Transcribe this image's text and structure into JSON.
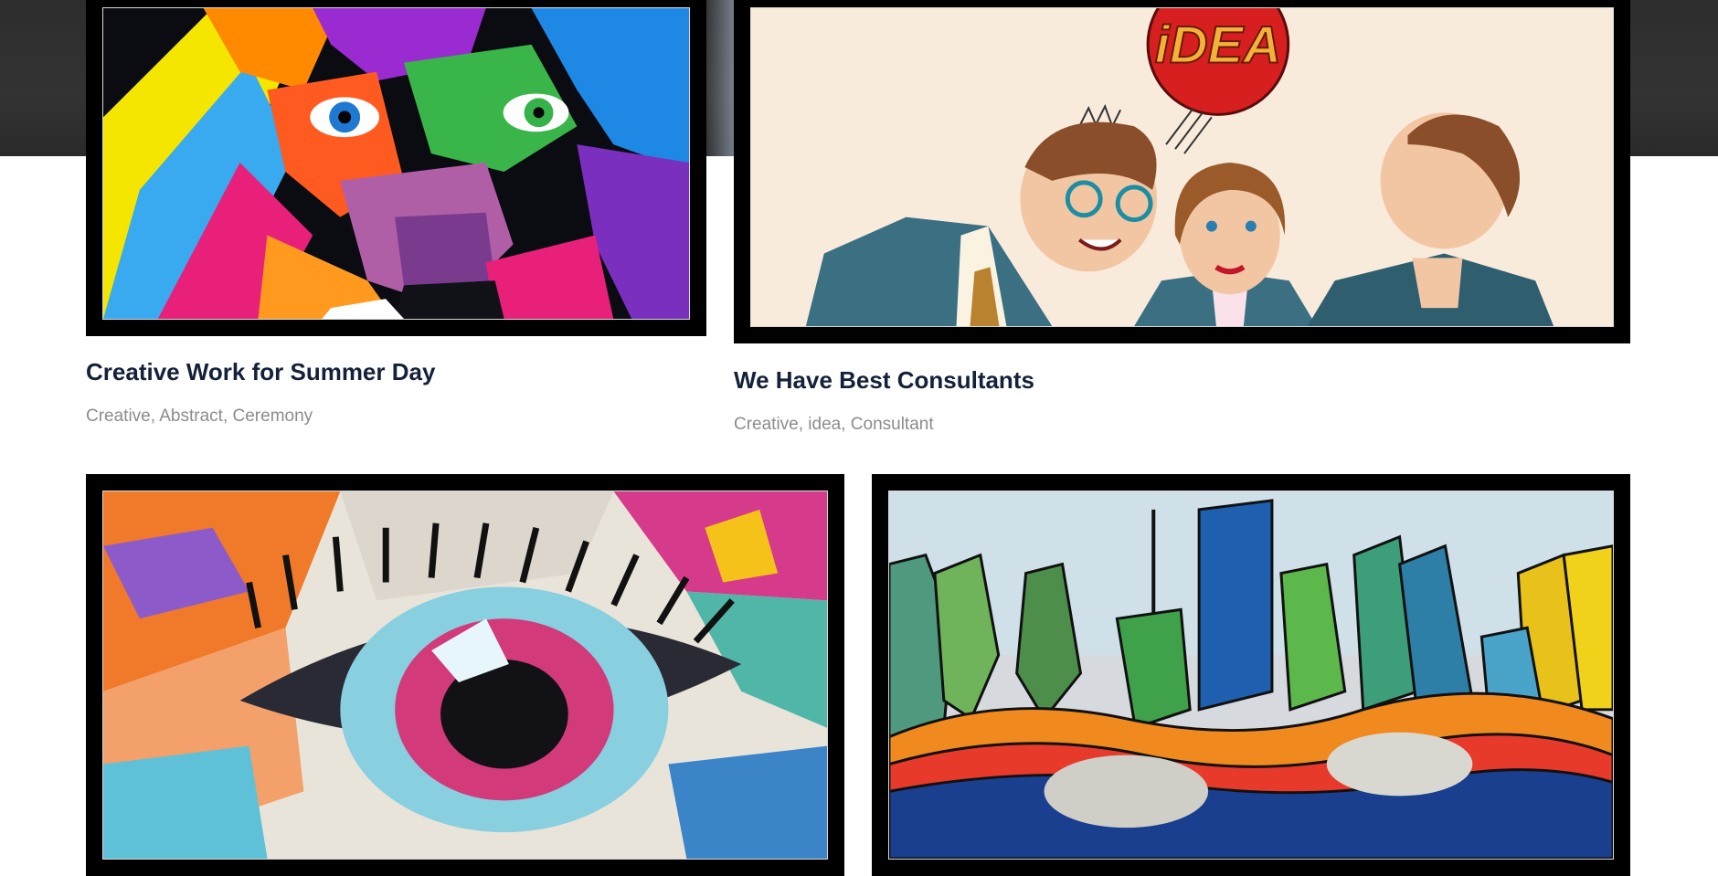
{
  "page": {
    "background": "#ffffff",
    "hero_band_color": "#2e2e2e",
    "title_color": "#13213a",
    "tags_color": "#8c8c8c"
  },
  "portfolio": {
    "items": [
      {
        "title": "Creative Work for Summer Day",
        "tags": "Creative, Abstract, Ceremony",
        "image": "colorful-lion-painting"
      },
      {
        "title": "We Have Best Consultants",
        "tags": "Creative, idea, Consultant",
        "image": "pop-art-consultants-idea"
      },
      {
        "title": "",
        "tags": "",
        "image": "colorful-eye-painting"
      },
      {
        "title": "",
        "tags": "",
        "image": "colorful-city-skyline-painting"
      }
    ],
    "idea_bubble_text": "iDEA"
  }
}
